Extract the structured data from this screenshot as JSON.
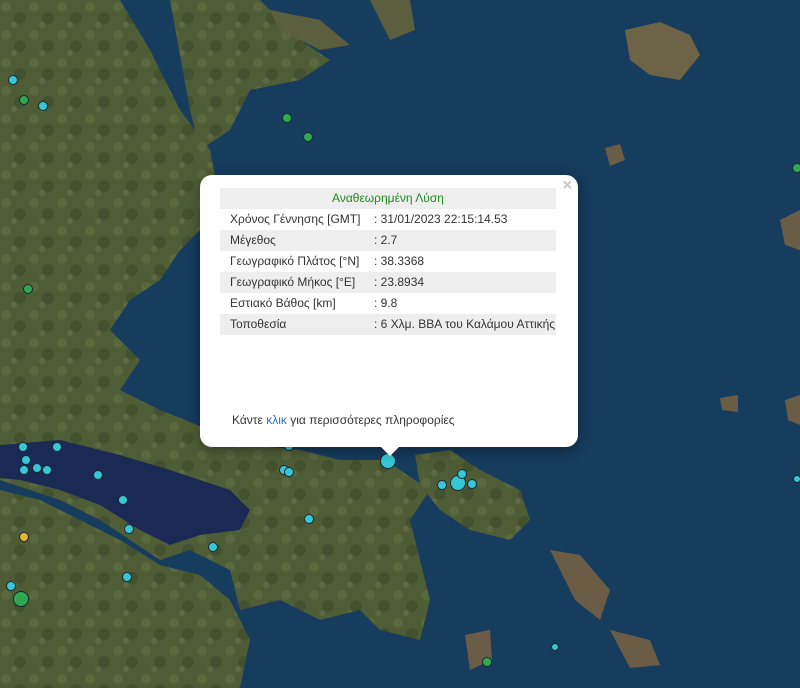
{
  "popup": {
    "title": "Αναθεωρημένη Λύση",
    "close_label": "×",
    "rows": [
      {
        "label": "Χρόνος Γέννησης [GMT]",
        "value": ": 31/01/2023 22:15:14.53"
      },
      {
        "label": "Μέγεθος",
        "value": ": 2.7"
      },
      {
        "label": "Γεωγραφικό Πλάτος [°N]",
        "value": ": 38.3368"
      },
      {
        "label": "Γεωγραφικό Μήκος [°E]",
        "value": ": 23.8934"
      },
      {
        "label": "Εστιακό Βάθος [km]",
        "value": ": 9.8"
      },
      {
        "label": "Τοποθεσία",
        "value": ": 6 Χλμ. ΒΒΑ του Καλάμου Αττικής"
      }
    ],
    "more_prefix": "Κάντε ",
    "more_link": "κλικ",
    "more_suffix": " για περισσότερες πληροφορίες"
  },
  "colors": {
    "sea": "#143a5c",
    "land": "#4e5b36",
    "marker_cyan": "#36c6d6",
    "marker_green": "#2fa84f",
    "marker_yellow": "#e6b534",
    "title_green": "#1e8a1e"
  }
}
